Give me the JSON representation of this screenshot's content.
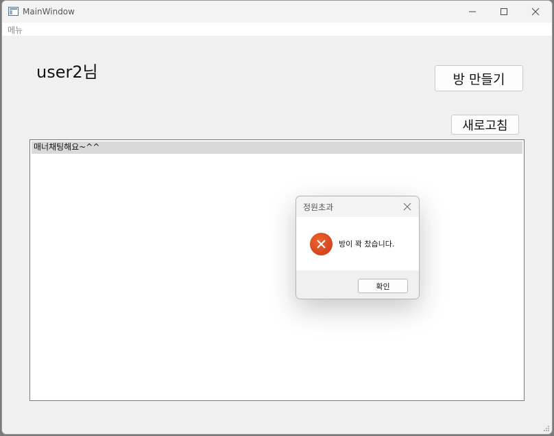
{
  "window": {
    "title": "MainWindow",
    "menu": "메뉴"
  },
  "main": {
    "user_label": "user2님",
    "create_room_label": "방 만들기",
    "refresh_label": "새로고침",
    "rooms": [
      "매너채팅해요~^^"
    ]
  },
  "dialog": {
    "title": "정원초과",
    "icon": "error-icon",
    "message": "방이 꽉 찼습니다.",
    "ok_label": "확인"
  },
  "colors": {
    "error": "#d8441f",
    "selection": "#d9d9d9"
  }
}
